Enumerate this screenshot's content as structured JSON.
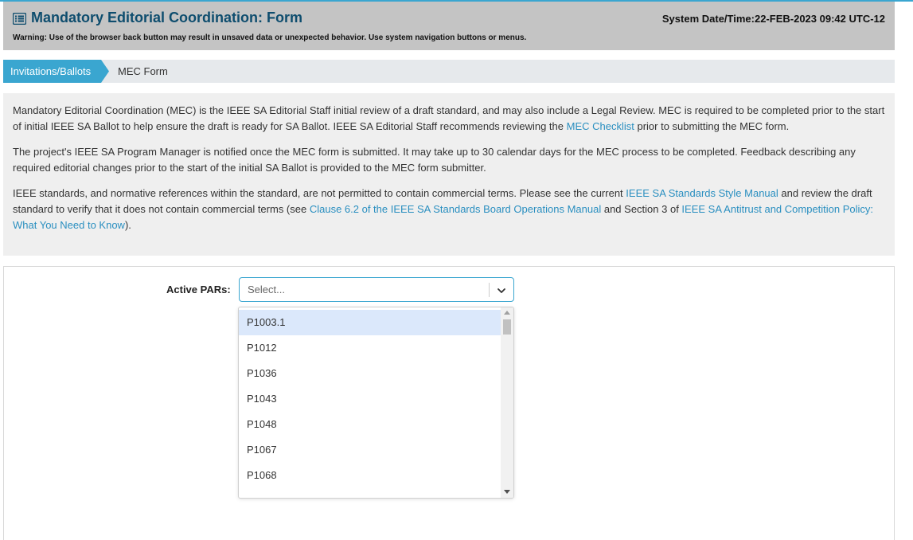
{
  "header": {
    "title": "Mandatory Editorial Coordination: Form",
    "datetime": "System Date/Time:22-FEB-2023 09:42 UTC-12",
    "warning": "Warning: Use of the browser back button may result in unsaved data or unexpected behavior. Use system navigation buttons or menus.",
    "icon": "list-icon"
  },
  "breadcrumb": {
    "parent": "Invitations/Ballots",
    "current": "MEC Form"
  },
  "info": {
    "p1_text1": "Mandatory Editorial Coordination (MEC) is the IEEE SA Editorial Staff initial review of a draft standard, and may also include a Legal Review. MEC is required to be completed prior to the start of initial IEEE SA Ballot to help ensure the draft is ready for SA Ballot. IEEE SA Editorial Staff recommends reviewing the ",
    "p1_link": "MEC Checklist",
    "p1_text2": " prior to submitting the MEC form.",
    "p2_text": "The project's IEEE SA Program Manager is notified once the MEC form is submitted. It may take up to 30 calendar days for the MEC process to be completed. Feedback describing any required editorial changes prior to the start of the initial SA Ballot is provided to the MEC form submitter.",
    "p3_text1": "IEEE standards, and normative references within the standard, are not permitted to contain commercial terms. Please see the current ",
    "p3_link1": "IEEE SA Standards Style Manual",
    "p3_text2": " and review the draft standard to verify that it does not contain commercial terms (see ",
    "p3_link2": "Clause 6.2 of the IEEE SA Standards Board Operations Manual",
    "p3_text3": " and Section 3 of ",
    "p3_link3": "IEEE SA Antitrust and Competition Policy: What You Need to Know",
    "p3_text4": ")."
  },
  "form": {
    "active_pars_label": "Active PARs:",
    "active_pars_placeholder": "Select...",
    "options": [
      "P1003.1",
      "P1012",
      "P1036",
      "P1043",
      "P1048",
      "P1067",
      "P1068"
    ]
  },
  "colors": {
    "accent": "#3aa6d0",
    "title": "#0e4d6e",
    "link": "#2a8fc0",
    "header_bg": "#c4c4c4",
    "highlight": "#dbe8fb"
  }
}
